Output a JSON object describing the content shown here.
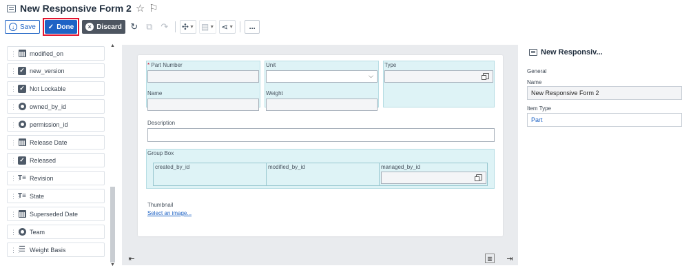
{
  "header": {
    "title": "New Responsive Form 2"
  },
  "toolbar": {
    "save_label": "Save",
    "done_label": "Done",
    "discard_label": "Discard",
    "more_label": "..."
  },
  "sidebar": {
    "items": [
      {
        "label": "modified_on",
        "icon": "calendar-icon"
      },
      {
        "label": "new_version",
        "icon": "checkbox-icon"
      },
      {
        "label": "Not Lockable",
        "icon": "checkbox-icon"
      },
      {
        "label": "owned_by_id",
        "icon": "item-icon"
      },
      {
        "label": "permission_id",
        "icon": "item-icon"
      },
      {
        "label": "Release Date",
        "icon": "calendar-icon"
      },
      {
        "label": "Released",
        "icon": "checkbox-icon"
      },
      {
        "label": "Revision",
        "icon": "text-icon"
      },
      {
        "label": "State",
        "icon": "text-icon"
      },
      {
        "label": "Superseded Date",
        "icon": "calendar-icon"
      },
      {
        "label": "Team",
        "icon": "item-icon"
      },
      {
        "label": "Weight Basis",
        "icon": "list-icon"
      }
    ]
  },
  "form": {
    "part_number": {
      "label": "Part Number",
      "required": "*"
    },
    "unit": {
      "label": "Unit"
    },
    "type": {
      "label": "Type"
    },
    "name": {
      "label": "Name"
    },
    "weight": {
      "label": "Weight"
    },
    "description": {
      "label": "Description"
    },
    "group_box": {
      "label": "Group Box",
      "fields": [
        "created_by_id",
        "modified_by_id",
        "managed_by_id"
      ]
    },
    "thumbnail": {
      "label": "Thumbnail",
      "link": "Select an image..."
    }
  },
  "properties": {
    "title": "New Responsiv...",
    "section": "General",
    "name_label": "Name",
    "name_value": "New Responsive Form 2",
    "item_type_label": "Item Type",
    "item_type_value": "Part"
  },
  "colors": {
    "accent": "#1e63c5",
    "discard": "#4d5560",
    "highlight_border": "#e3132e",
    "cell_fill": "#def3f6"
  }
}
